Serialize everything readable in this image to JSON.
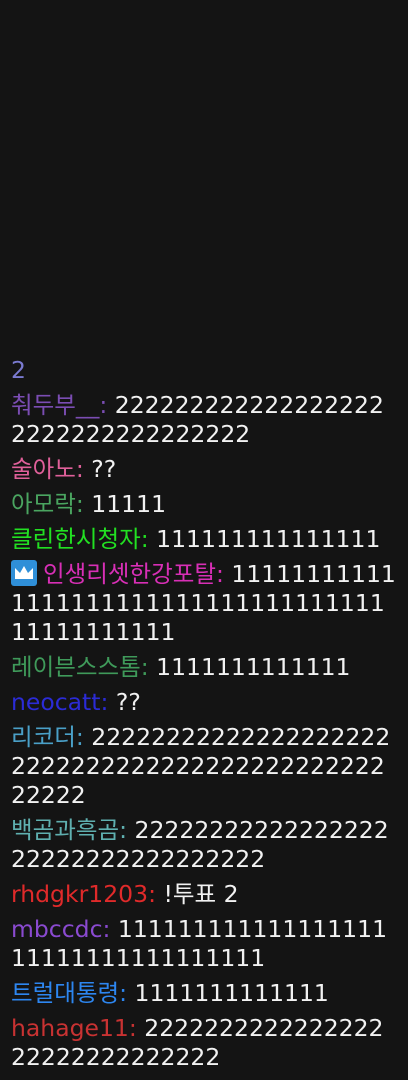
{
  "chat": {
    "messages": [
      {
        "user": "",
        "sep": "",
        "text": "2",
        "color": "#7a7ad0"
      },
      {
        "user": "춰두부__",
        "sep": ":",
        "text": "2222222222222222222222222222222222",
        "color": "#7b4db3"
      },
      {
        "user": "술아노",
        "sep": ":",
        "text": "??",
        "color": "#e0609a"
      },
      {
        "user": "아모락",
        "sep": ":",
        "text": "11111",
        "color": "#4aa560"
      },
      {
        "user": "클린한시청자",
        "sep": ":",
        "text": "111111111111111",
        "color": "#22e022"
      },
      {
        "user": "인생리셋한강포탈",
        "sep": ":",
        "text": "11111111111111111111111111111111111111111111111",
        "color": "#d82fb6",
        "badge": "crown-icon"
      },
      {
        "user": "레이븐스스톰",
        "sep": ":",
        "text": "1111111111111",
        "color": "#3f9a5a"
      },
      {
        "user": "neocatt",
        "sep": ":",
        "text": "??",
        "color": "#2b2bd6"
      },
      {
        "user": "리코더",
        "sep": ":",
        "text": "22222222222222222222222222222222222222222222222222",
        "color": "#4aa0c8"
      },
      {
        "user": "백곰과흑곰",
        "sep": ":",
        "text": "2222222222222222222222222222222222",
        "color": "#5fb0b0"
      },
      {
        "user": "rhdgkr1203",
        "sep": ":",
        "text": "!투표 2",
        "color": "#e02a2a"
      },
      {
        "user": "mbccdc",
        "sep": ":",
        "text": "11111111111111111111111111111111111",
        "color": "#8a4ad0"
      },
      {
        "user": "트럴대통령",
        "sep": ":",
        "text": "1111111111111",
        "color": "#2d86f0"
      },
      {
        "user": "hahage11",
        "sep": ":",
        "text": "222222222222222222222222222222",
        "color": "#c83232"
      }
    ]
  }
}
